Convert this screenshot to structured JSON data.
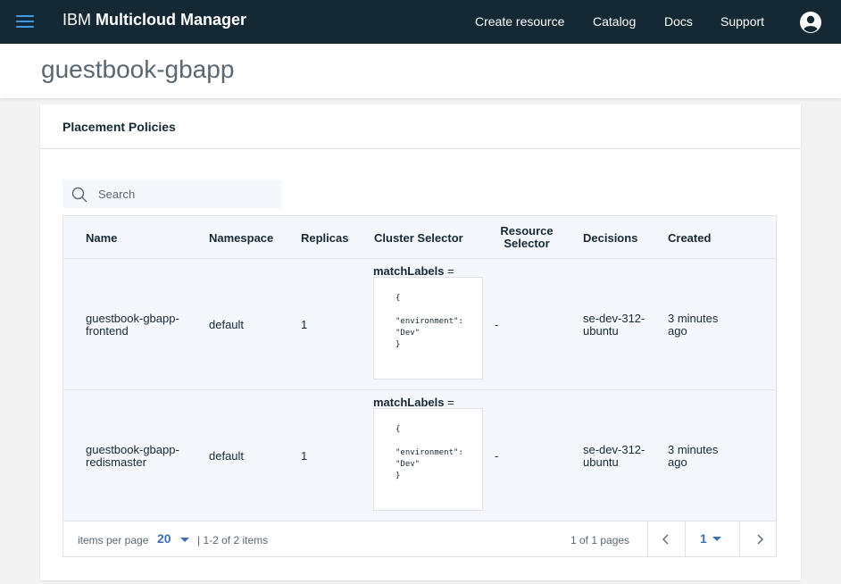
{
  "header": {
    "brand_prefix": "IBM",
    "brand_name": "Multicloud Manager",
    "nav": [
      "Create resource",
      "Catalog",
      "Docs",
      "Support"
    ],
    "accent_color": "#3d9be9",
    "bar_color": "#152935"
  },
  "page": {
    "title": "guestbook-gbapp"
  },
  "card": {
    "title": "Placement Policies",
    "search_placeholder": "Search",
    "columns": {
      "name": "Name",
      "namespace": "Namespace",
      "replicas": "Replicas",
      "cluster_selector": "Cluster Selector",
      "resource_selector_l1": "Resource",
      "resource_selector_l2": "Selector",
      "decisions": "Decisions",
      "created": "Created"
    },
    "rows": [
      {
        "name_l1": "guestbook-gbapp-",
        "name_l2": "frontend",
        "namespace": "default",
        "replicas": "1",
        "match_labels": "matchLabels",
        "match_eq": " =",
        "code": [
          "{",
          "\"environment\":",
          "\"Dev\"",
          "}"
        ],
        "resource_selector": "-",
        "decisions_l1": "se-dev-312-",
        "decisions_l2": "ubuntu",
        "created_l1": "3 minutes",
        "created_l2": "ago"
      },
      {
        "name_l1": "guestbook-gbapp-",
        "name_l2": "redismaster",
        "namespace": "default",
        "replicas": "1",
        "match_labels": "matchLabels",
        "match_eq": " =",
        "code": [
          "{",
          "\"environment\":",
          "\"Dev\"",
          "}"
        ],
        "resource_selector": "-",
        "decisions_l1": "se-dev-312-",
        "decisions_l2": "ubuntu",
        "created_l1": "3 minutes",
        "created_l2": "ago"
      }
    ],
    "pagination": {
      "items_per_page_label": "items per page",
      "items_per_page": "20",
      "range": "|  1-2 of 2 items",
      "pages": "1 of 1 pages",
      "current_page": "1",
      "link_color": "#3d70b2"
    }
  }
}
